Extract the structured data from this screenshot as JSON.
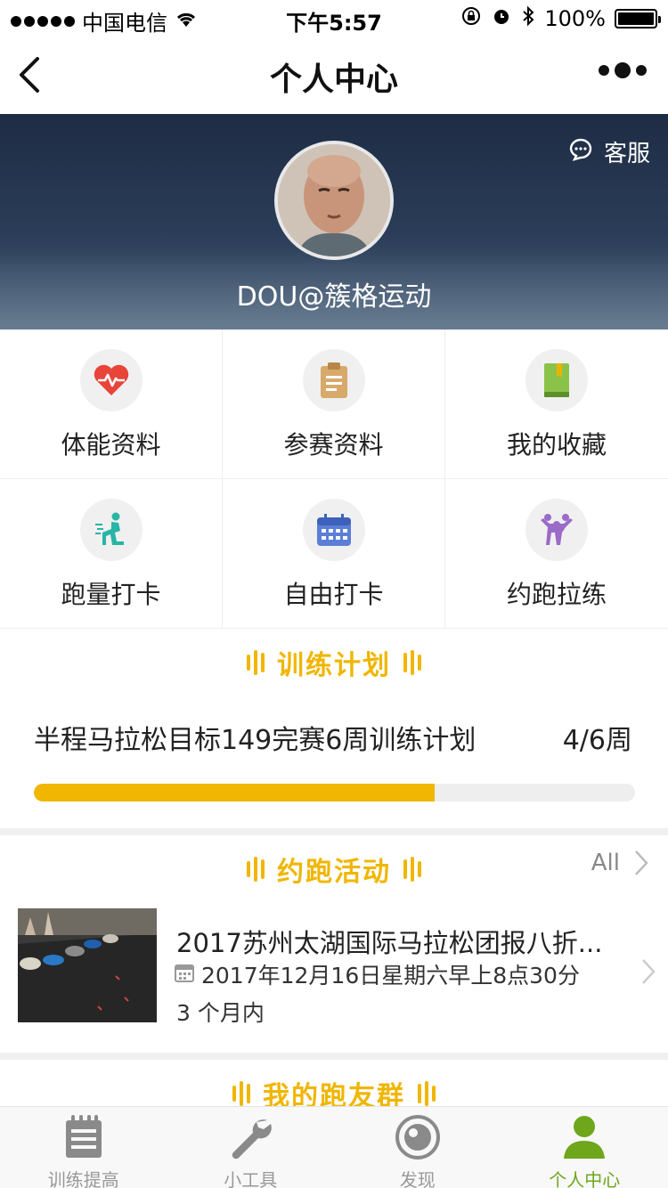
{
  "status_bar": {
    "carrier": "中国电信",
    "time": "下午5:57",
    "battery": "100%"
  },
  "nav": {
    "title": "个人中心"
  },
  "header": {
    "service_label": "客服",
    "username": "DOU@簇格运动"
  },
  "menu": [
    {
      "label": "体能资料",
      "icon": "heart-rate-icon"
    },
    {
      "label": "参赛资料",
      "icon": "clipboard-icon"
    },
    {
      "label": "我的收藏",
      "icon": "book-icon"
    },
    {
      "label": "跑量打卡",
      "icon": "runner-icon"
    },
    {
      "label": "自由打卡",
      "icon": "calendar-icon"
    },
    {
      "label": "约跑拉练",
      "icon": "group-icon"
    }
  ],
  "training_plan": {
    "section_title": "训练计划",
    "plan_name": "半程马拉松目标149完赛6周训练计划",
    "progress_text": "4/6周",
    "progress_fraction": 0.667
  },
  "activities": {
    "section_title": "约跑活动",
    "all_label": "All",
    "items": [
      {
        "title": "2017苏州太湖国际马拉松团报八折...",
        "date": "2017年12月16日星期六早上8点30分",
        "time_label": "3 个月内"
      }
    ]
  },
  "groups": {
    "section_title": "我的跑友群"
  },
  "colors": {
    "accent": "#f0b600",
    "tab_active": "#6ea61c",
    "tab_inactive": "#999999"
  },
  "tabs": [
    {
      "label": "训练提高",
      "icon": "list-icon",
      "active": false
    },
    {
      "label": "小工具",
      "icon": "wrench-icon",
      "active": false
    },
    {
      "label": "发现",
      "icon": "compass-icon",
      "active": false
    },
    {
      "label": "个人中心",
      "icon": "person-icon",
      "active": true
    }
  ]
}
